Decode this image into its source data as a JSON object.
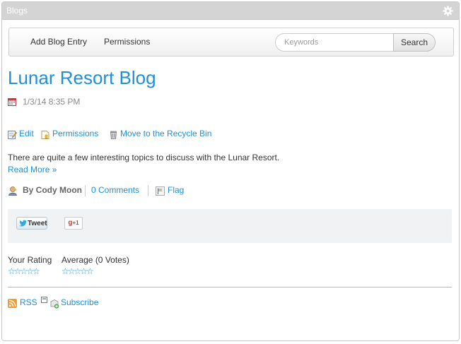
{
  "portlet": {
    "title": "Blogs"
  },
  "navbar": {
    "items": [
      {
        "label": "Add Blog Entry"
      },
      {
        "label": "Permissions"
      }
    ],
    "search": {
      "placeholder": "Keywords",
      "value": "",
      "button_label": "Search"
    }
  },
  "entry": {
    "title": "Lunar Resort Blog",
    "date": "1/3/14 8:35 PM",
    "actions": [
      {
        "label": "Edit",
        "icon": "edit-icon"
      },
      {
        "label": "Permissions",
        "icon": "permissions-icon"
      },
      {
        "label": "Move to the Recycle Bin",
        "icon": "recycle-bin-icon"
      }
    ],
    "body": "There are quite a few interesting topics to discuss with the Lunar Resort.",
    "read_more": "Read More »",
    "author": "By Cody Moon",
    "comments": "0 Comments",
    "flag": "Flag"
  },
  "social": {
    "tweet_label": "Tweet",
    "gplus_label": "+1"
  },
  "ratings": {
    "your_rating_label": "Your Rating",
    "average_label": "Average (0 Votes)",
    "your_stars": "☆☆☆☆☆",
    "average_stars": "☆☆☆☆☆"
  },
  "footer": {
    "rss_label": "RSS",
    "subscribe_label": "Subscribe"
  },
  "colors": {
    "link": "#1f8fd6",
    "title_bar": "#d4d4d4",
    "social_bg": "#f0f2f4"
  }
}
